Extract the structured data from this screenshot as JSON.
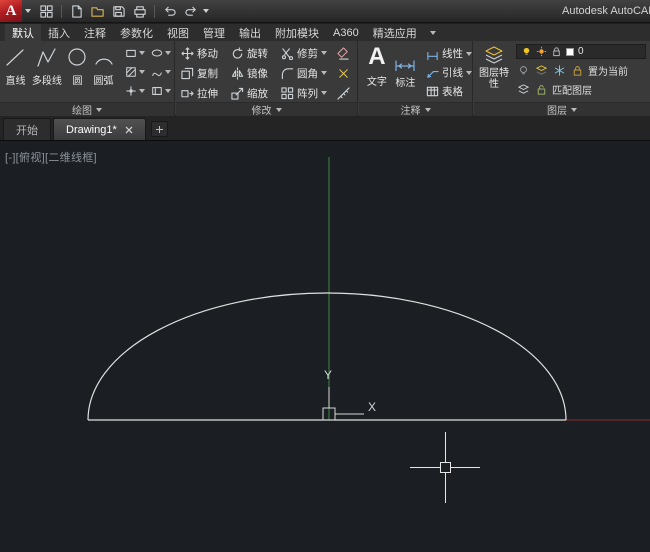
{
  "titlebar": {
    "logo_letter": "A",
    "app_title": "Autodesk AutoCAD",
    "qat_icons": [
      "workspace-switcher",
      "new-file",
      "open-file",
      "save",
      "plot",
      "undo",
      "redo"
    ]
  },
  "menubar": {
    "tabs": [
      "默认",
      "插入",
      "注释",
      "参数化",
      "视图",
      "管理",
      "输出",
      "附加模块",
      "A360",
      "精选应用"
    ],
    "active_tab": "默认"
  },
  "ribbon": {
    "draw": {
      "title": "绘图",
      "buttons": [
        "直线",
        "多段线",
        "圆",
        "圆弧"
      ]
    },
    "modify": {
      "title": "修改",
      "col1": [
        "移动",
        "复制",
        "拉伸"
      ],
      "col2": [
        "旋转",
        "镜像",
        "缩放"
      ],
      "col3": [
        "修剪",
        "圆角",
        "阵列"
      ]
    },
    "annotate": {
      "title": "注释",
      "text_glyph": "A",
      "big_buttons": [
        "文字",
        "标注"
      ],
      "small_buttons": [
        "线性",
        "引线",
        "表格"
      ]
    },
    "layers": {
      "title": "图层",
      "properties_button": "图层特性",
      "current_layer": "0",
      "commands": [
        "置为当前",
        "匹配图层"
      ]
    }
  },
  "filetabs": {
    "tabs": [
      "开始",
      "Drawing1*"
    ],
    "active_tab": "Drawing1*"
  },
  "canvas": {
    "viewport_label": "[-][俯视][二维线框]",
    "ucs": {
      "x_label": "X",
      "y_label": "Y"
    },
    "colors": {
      "background": "#1b1e22",
      "x_axis": "#8a2f2f",
      "y_axis": "#3d8b3d",
      "geometry": "#e0e0e0",
      "crosshair": "#e6e6e6"
    }
  }
}
